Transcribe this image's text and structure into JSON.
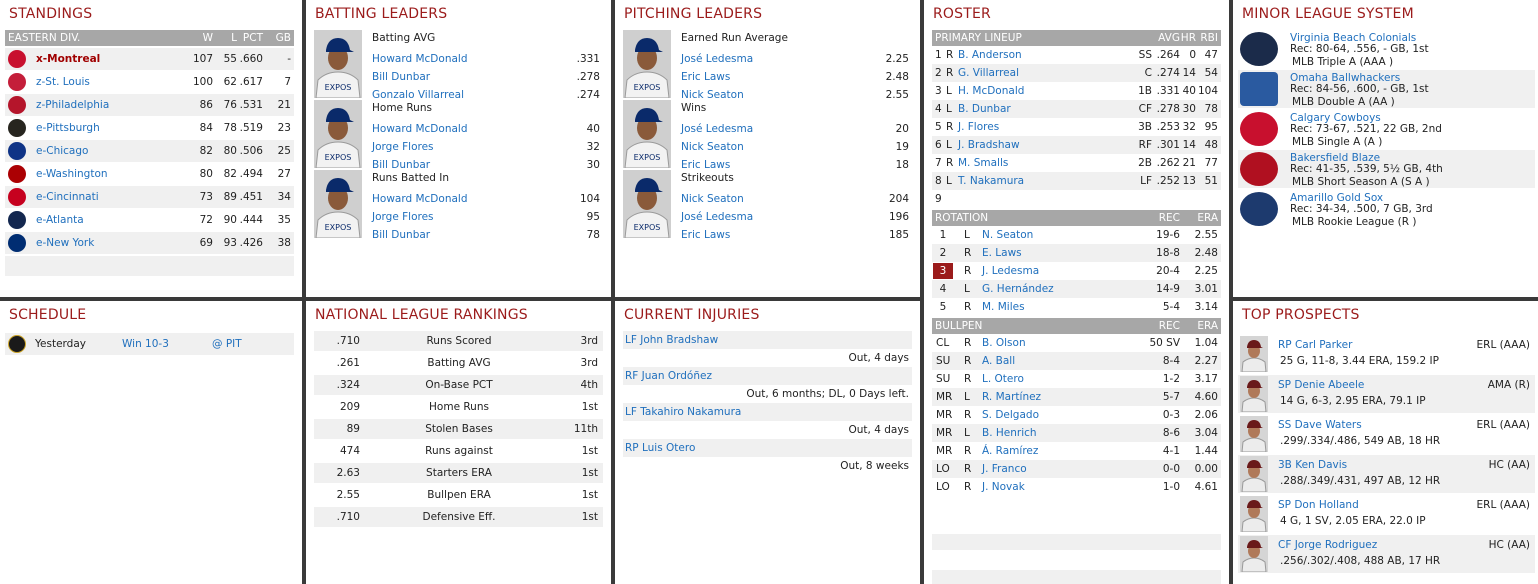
{
  "standings": {
    "title": "STANDINGS",
    "header": {
      "div": "EASTERN DIV.",
      "w": "W",
      "l": "L",
      "pct": "PCT",
      "gb": "GB"
    },
    "rows": [
      {
        "team": "x-Montreal",
        "w": "107",
        "l": "55",
        "pct": ".660",
        "gb": "-",
        "color": "#c8102e"
      },
      {
        "team": "z-St. Louis",
        "w": "100",
        "l": "62",
        "pct": ".617",
        "gb": "7",
        "color": "#c41e3a"
      },
      {
        "team": "z-Philadelphia",
        "w": "86",
        "l": "76",
        "pct": ".531",
        "gb": "21",
        "color": "#b5152b"
      },
      {
        "team": "e-Pittsburgh",
        "w": "84",
        "l": "78",
        "pct": ".519",
        "gb": "23",
        "color": "#27251f"
      },
      {
        "team": "e-Chicago",
        "w": "82",
        "l": "80",
        "pct": ".506",
        "gb": "25",
        "color": "#0e3386"
      },
      {
        "team": "e-Washington",
        "w": "80",
        "l": "82",
        "pct": ".494",
        "gb": "27",
        "color": "#ab0003"
      },
      {
        "team": "e-Cincinnati",
        "w": "73",
        "l": "89",
        "pct": ".451",
        "gb": "34",
        "color": "#c6011f"
      },
      {
        "team": "e-Atlanta",
        "w": "72",
        "l": "90",
        "pct": ".444",
        "gb": "35",
        "color": "#13274f"
      },
      {
        "team": "e-New York",
        "w": "69",
        "l": "93",
        "pct": ".426",
        "gb": "38",
        "color": "#002d72"
      }
    ]
  },
  "batting": {
    "title": "BATTING LEADERS",
    "groups": [
      {
        "category": "Batting AVG",
        "players": [
          {
            "name": "Howard McDonald",
            "value": ".331"
          },
          {
            "name": "Bill Dunbar",
            "value": ".278"
          },
          {
            "name": "Gonzalo Villarreal",
            "value": ".274"
          }
        ]
      },
      {
        "category": "Home Runs",
        "players": [
          {
            "name": "Howard McDonald",
            "value": "40"
          },
          {
            "name": "Jorge Flores",
            "value": "32"
          },
          {
            "name": "Bill Dunbar",
            "value": "30"
          }
        ]
      },
      {
        "category": "Runs Batted In",
        "players": [
          {
            "name": "Howard McDonald",
            "value": "104"
          },
          {
            "name": "Jorge Flores",
            "value": "95"
          },
          {
            "name": "Bill Dunbar",
            "value": "78"
          }
        ]
      }
    ]
  },
  "pitching": {
    "title": "PITCHING LEADERS",
    "groups": [
      {
        "category": "Earned Run Average",
        "players": [
          {
            "name": "José Ledesma",
            "value": "2.25"
          },
          {
            "name": "Eric Laws",
            "value": "2.48"
          },
          {
            "name": "Nick Seaton",
            "value": "2.55"
          }
        ]
      },
      {
        "category": "Wins",
        "players": [
          {
            "name": "José Ledesma",
            "value": "20"
          },
          {
            "name": "Nick Seaton",
            "value": "19"
          },
          {
            "name": "Eric Laws",
            "value": "18"
          }
        ]
      },
      {
        "category": "Strikeouts",
        "players": [
          {
            "name": "Nick Seaton",
            "value": "204"
          },
          {
            "name": "José Ledesma",
            "value": "196"
          },
          {
            "name": "Eric Laws",
            "value": "185"
          }
        ]
      }
    ]
  },
  "roster": {
    "title": "ROSTER",
    "lineup_header": {
      "label": "PRIMARY LINEUP",
      "avg": "AVG",
      "hr": "HR",
      "rbi": "RBI"
    },
    "lineup": [
      {
        "n": "1",
        "hand": "R",
        "name": "B. Anderson",
        "pos": "SS",
        "avg": ".264",
        "hr": "0",
        "rbi": "47"
      },
      {
        "n": "2",
        "hand": "R",
        "name": "G. Villarreal",
        "pos": "C",
        "avg": ".274",
        "hr": "14",
        "rbi": "54"
      },
      {
        "n": "3",
        "hand": "L",
        "name": "H. McDonald",
        "pos": "1B",
        "avg": ".331",
        "hr": "40",
        "rbi": "104"
      },
      {
        "n": "4",
        "hand": "L",
        "name": "B. Dunbar",
        "pos": "CF",
        "avg": ".278",
        "hr": "30",
        "rbi": "78"
      },
      {
        "n": "5",
        "hand": "R",
        "name": "J. Flores",
        "pos": "3B",
        "avg": ".253",
        "hr": "32",
        "rbi": "95"
      },
      {
        "n": "6",
        "hand": "L",
        "name": "J. Bradshaw",
        "pos": "RF",
        "avg": ".301",
        "hr": "14",
        "rbi": "48"
      },
      {
        "n": "7",
        "hand": "R",
        "name": "M. Smalls",
        "pos": "2B",
        "avg": ".262",
        "hr": "21",
        "rbi": "77"
      },
      {
        "n": "8",
        "hand": "L",
        "name": "T. Nakamura",
        "pos": "LF",
        "avg": ".252",
        "hr": "13",
        "rbi": "51"
      },
      {
        "n": "9",
        "hand": "",
        "name": "",
        "pos": "",
        "avg": "",
        "hr": "",
        "rbi": ""
      }
    ],
    "rotation_header": {
      "label": "ROTATION",
      "rec": "REC",
      "era": "ERA"
    },
    "rotation": [
      {
        "n": "1",
        "hand": "L",
        "name": "N. Seaton",
        "rec": "19-6",
        "era": "2.55"
      },
      {
        "n": "2",
        "hand": "R",
        "name": "E. Laws",
        "rec": "18-8",
        "era": "2.48"
      },
      {
        "n": "3",
        "hand": "R",
        "name": "J. Ledesma",
        "rec": "20-4",
        "era": "2.25"
      },
      {
        "n": "4",
        "hand": "L",
        "name": "G. Hernández",
        "rec": "14-9",
        "era": "3.01"
      },
      {
        "n": "5",
        "hand": "R",
        "name": "M. Miles",
        "rec": "5-4",
        "era": "3.14"
      }
    ],
    "bullpen_header": {
      "label": "BULLPEN",
      "rec": "REC",
      "era": "ERA"
    },
    "bullpen": [
      {
        "role": "CL",
        "hand": "R",
        "name": "B. Olson",
        "rec": "50 SV",
        "era": "1.04"
      },
      {
        "role": "SU",
        "hand": "R",
        "name": "A. Ball",
        "rec": "8-4",
        "era": "2.27"
      },
      {
        "role": "SU",
        "hand": "R",
        "name": "L. Otero",
        "rec": "1-2",
        "era": "3.17"
      },
      {
        "role": "MR",
        "hand": "L",
        "name": "R. Martínez",
        "rec": "5-7",
        "era": "4.60"
      },
      {
        "role": "MR",
        "hand": "R",
        "name": "S. Delgado",
        "rec": "0-3",
        "era": "2.06"
      },
      {
        "role": "MR",
        "hand": "L",
        "name": "B. Henrich",
        "rec": "8-6",
        "era": "3.04"
      },
      {
        "role": "MR",
        "hand": "R",
        "name": "Á. Ramírez",
        "rec": "4-1",
        "era": "1.44"
      },
      {
        "role": "LO",
        "hand": "R",
        "name": "J. Franco",
        "rec": "0-0",
        "era": "0.00"
      },
      {
        "role": "LO",
        "hand": "R",
        "name": "J. Novak",
        "rec": "1-0",
        "era": "4.61"
      }
    ]
  },
  "minors": {
    "title": "MINOR LEAGUE SYSTEM",
    "teams": [
      {
        "name": "Virginia Beach Colonials",
        "rec": "Rec: 80-64, .556, - GB, 1st",
        "level": "MLB Triple A (AAA )",
        "color": "#1b2b4a"
      },
      {
        "name": "Omaha Ballwhackers",
        "rec": "Rec: 84-56, .600, - GB, 1st",
        "level": "MLB Double A (AA )",
        "color": "#2a5aa0"
      },
      {
        "name": "Calgary Cowboys",
        "rec": "Rec: 73-67, .521, 22 GB, 2nd",
        "level": "MLB Single A (A )",
        "color": "#c8102e"
      },
      {
        "name": "Bakersfield Blaze",
        "rec": "Rec: 41-35, .539, 5½ GB, 4th",
        "level": "MLB Short Season A (S A )",
        "color": "#b01020"
      },
      {
        "name": "Amarillo Gold Sox",
        "rec": "Rec: 34-34, .500, 7 GB, 3rd",
        "level": "MLB Rookie League (R )",
        "color": "#1d3a6e"
      }
    ]
  },
  "schedule": {
    "title": "SCHEDULE",
    "games": [
      {
        "day": "Yesterday",
        "result": "Win 10-3",
        "opp": "@ PIT"
      }
    ]
  },
  "rankings": {
    "title": "NATIONAL LEAGUE RANKINGS",
    "rows": [
      {
        "value": ".710",
        "stat": "Runs Scored",
        "rank": "3rd"
      },
      {
        "value": ".261",
        "stat": "Batting AVG",
        "rank": "3rd"
      },
      {
        "value": ".324",
        "stat": "On-Base PCT",
        "rank": "4th"
      },
      {
        "value": "209",
        "stat": "Home Runs",
        "rank": "1st"
      },
      {
        "value": "89",
        "stat": "Stolen Bases",
        "rank": "11th"
      },
      {
        "value": "474",
        "stat": "Runs against",
        "rank": "1st"
      },
      {
        "value": "2.63",
        "stat": "Starters ERA",
        "rank": "1st"
      },
      {
        "value": "2.55",
        "stat": "Bullpen ERA",
        "rank": "1st"
      },
      {
        "value": ".710",
        "stat": "Defensive Eff.",
        "rank": "1st"
      }
    ]
  },
  "injuries": {
    "title": "CURRENT INJURIES",
    "list": [
      {
        "player": "LF John Bradshaw",
        "status": "Out, 4 days"
      },
      {
        "player": "RF Juan Ordóñez",
        "status": "Out, 6 months; DL, 0 Days left."
      },
      {
        "player": "LF Takahiro Nakamura",
        "status": "Out, 4 days"
      },
      {
        "player": "RP Luis Otero",
        "status": "Out, 8 weeks"
      }
    ]
  },
  "prospects": {
    "title": "TOP PROSPECTS",
    "list": [
      {
        "name": "RP Carl Parker",
        "team": "ERL (AAA)",
        "line": "25 G, 11-8, 3.44 ERA, 159.2 IP"
      },
      {
        "name": "SP Denie Abeele",
        "team": "AMA (R)",
        "line": "14 G, 6-3, 2.95 ERA, 79.1 IP"
      },
      {
        "name": "SS Dave Waters",
        "team": "ERL (AAA)",
        "line": ".299/.334/.486, 549 AB, 18 HR"
      },
      {
        "name": "3B Ken Davis",
        "team": "HC (AA)",
        "line": ".288/.349/.431, 497 AB, 12 HR"
      },
      {
        "name": "SP Don Holland",
        "team": "ERL (AAA)",
        "line": "4 G, 1 SV, 2.05 ERA, 22.0 IP"
      },
      {
        "name": "CF Jorge Rodriguez",
        "team": "HC (AA)",
        "line": ".256/.302/.408, 488 AB, 17 HR"
      }
    ]
  }
}
